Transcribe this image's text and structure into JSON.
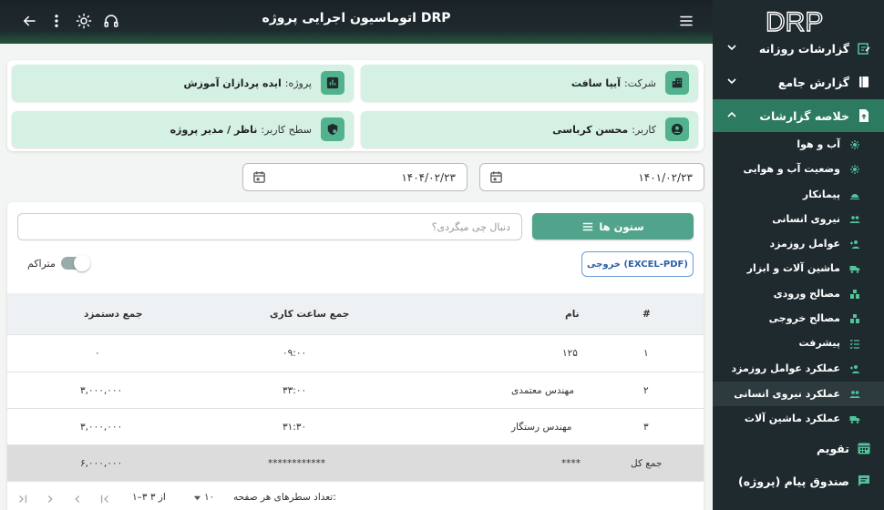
{
  "header": {
    "title": "اتوماسیون اجرایی پروژه DRP"
  },
  "logo": {
    "text": "DRP"
  },
  "sidebar": {
    "main_items": [
      {
        "label": "گزارشات روزانه",
        "icon": "report-edit-icon"
      },
      {
        "label": "گزارش جامع",
        "icon": "book-icon"
      },
      {
        "label": "خلاصه گزارشات",
        "icon": "file-upload-icon"
      }
    ],
    "sub_items": [
      {
        "label": "آب و هوا",
        "icon": "weather-icon"
      },
      {
        "label": "وضعیت آب و هوایی",
        "icon": "weather-icon"
      },
      {
        "label": "پیمانکار",
        "icon": "contractor-icon"
      },
      {
        "label": "نیروی انسانی",
        "icon": "people-icon"
      },
      {
        "label": "عوامل روزمزد",
        "icon": "person-add-icon"
      },
      {
        "label": "ماشین آلات و ابزار",
        "icon": "truck-icon"
      },
      {
        "label": "مصالح ورودی",
        "icon": "materials-icon"
      },
      {
        "label": "مصالح خروجی",
        "icon": "materials-icon"
      },
      {
        "label": "پیشرفت",
        "icon": "checklist-icon"
      },
      {
        "label": "عملکرد عوامل روزمزد",
        "icon": "person-add-icon"
      },
      {
        "label": "عملکرد نیروی انسانی",
        "icon": "people-icon"
      },
      {
        "label": "عملکرد ماشین آلات",
        "icon": "truck-icon"
      }
    ],
    "bottom_items": [
      {
        "label": "تقویم",
        "icon": "calendar-icon"
      },
      {
        "label": "صندوق پیام (پروژه)",
        "icon": "message-icon"
      }
    ]
  },
  "info": {
    "company_label": "شرکت:",
    "company_value": "آیپا سافت",
    "project_label": "پروژه:",
    "project_value": "ایده پردازان آموزش",
    "user_label": "کاربر:",
    "user_value": "محسن کرباسی",
    "level_label": "سطح کاربر:",
    "level_value": "ناظر / مدیر پروژه"
  },
  "dates": {
    "from": "۱۴۰۱/۰۲/۲۳",
    "to": "۱۴۰۴/۰۲/۲۳"
  },
  "toolbar": {
    "columns_label": "ستون ها",
    "search_placeholder": "دنبال چی میگردی؟",
    "export_label": "خروجی (EXCEL-PDF)",
    "cumulative_label": "متراکم"
  },
  "table": {
    "headers": [
      "#",
      "نام",
      "جمع ساعت کاری",
      "جمع دستمزد"
    ],
    "rows": [
      [
        "۱",
        "۱۲۵",
        "۰۹:۰۰",
        "۰"
      ],
      [
        "۲",
        "مهندس معتمدی",
        "۳۳:۰۰",
        "۳,۰۰۰,۰۰۰"
      ],
      [
        "۳",
        "مهندس رستگار",
        "۳۱:۳۰",
        "۳,۰۰۰,۰۰۰"
      ]
    ],
    "total": [
      "جمع کل",
      "****",
      "************",
      "۶,۰۰۰,۰۰۰"
    ]
  },
  "pagination": {
    "rows_per_page_label": "تعداد سطرهای هر صفحه:",
    "rows_per_page_value": "۱۰",
    "range": "۱–۳ از ۳"
  },
  "colors": {
    "accent": "#52a38b",
    "sidebar_bg": "#1f2a2e",
    "info_bg": "#d4f1e3"
  }
}
